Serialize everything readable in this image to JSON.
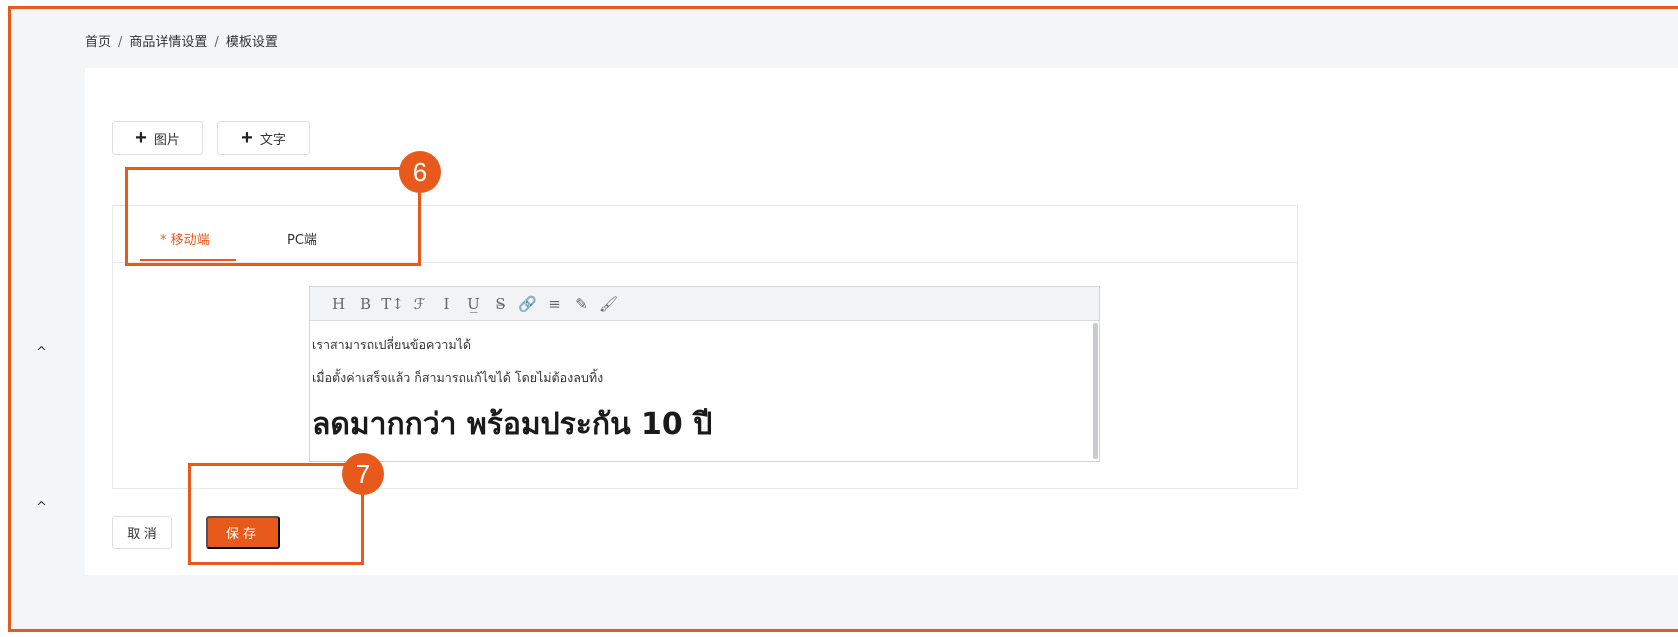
{
  "breadcrumb": {
    "home": "首页",
    "separator": "/",
    "level2": "商品详情设置",
    "current": "模板设置"
  },
  "add_buttons": {
    "image": {
      "icon": "+",
      "label": "图片"
    },
    "text": {
      "icon": "+",
      "label": "文字"
    }
  },
  "tabs": {
    "mobile": "* 移动端",
    "pc": "PC端",
    "active": "mobile"
  },
  "editor": {
    "toolbar": [
      {
        "name": "heading-icon",
        "glyph": "H"
      },
      {
        "name": "bold-icon",
        "glyph": "B"
      },
      {
        "name": "font-size-icon",
        "glyph": "T↕"
      },
      {
        "name": "font-family-icon",
        "glyph": "ℱ"
      },
      {
        "name": "italic-icon",
        "glyph": "I"
      },
      {
        "name": "underline-icon",
        "glyph": "U̲"
      },
      {
        "name": "strikethrough-icon",
        "glyph": "S̶"
      },
      {
        "name": "link-icon",
        "glyph": "🔗"
      },
      {
        "name": "align-icon",
        "glyph": "≡"
      },
      {
        "name": "highlighter-icon",
        "glyph": "✎"
      },
      {
        "name": "brush-icon",
        "glyph": "🖌"
      }
    ],
    "content": {
      "line1": "เราสามารถเปลี่ยนข้อความได้",
      "line2": "เมื่อตั้งค่าเสร็จแล้ว ก็สามารถแก้ไขได้ โดยไม่ต้องลบทิ้ง",
      "headline": "ลดมากกว่า พร้อมประกัน 10 ปี"
    }
  },
  "actions": {
    "cancel": "取 消",
    "save": "保存"
  },
  "side_carets": [
    "^",
    "^"
  ],
  "annotations": {
    "step6": "6",
    "step7": "7"
  },
  "colors": {
    "accent": "#e85a1b",
    "background": "#f4f5f7"
  }
}
